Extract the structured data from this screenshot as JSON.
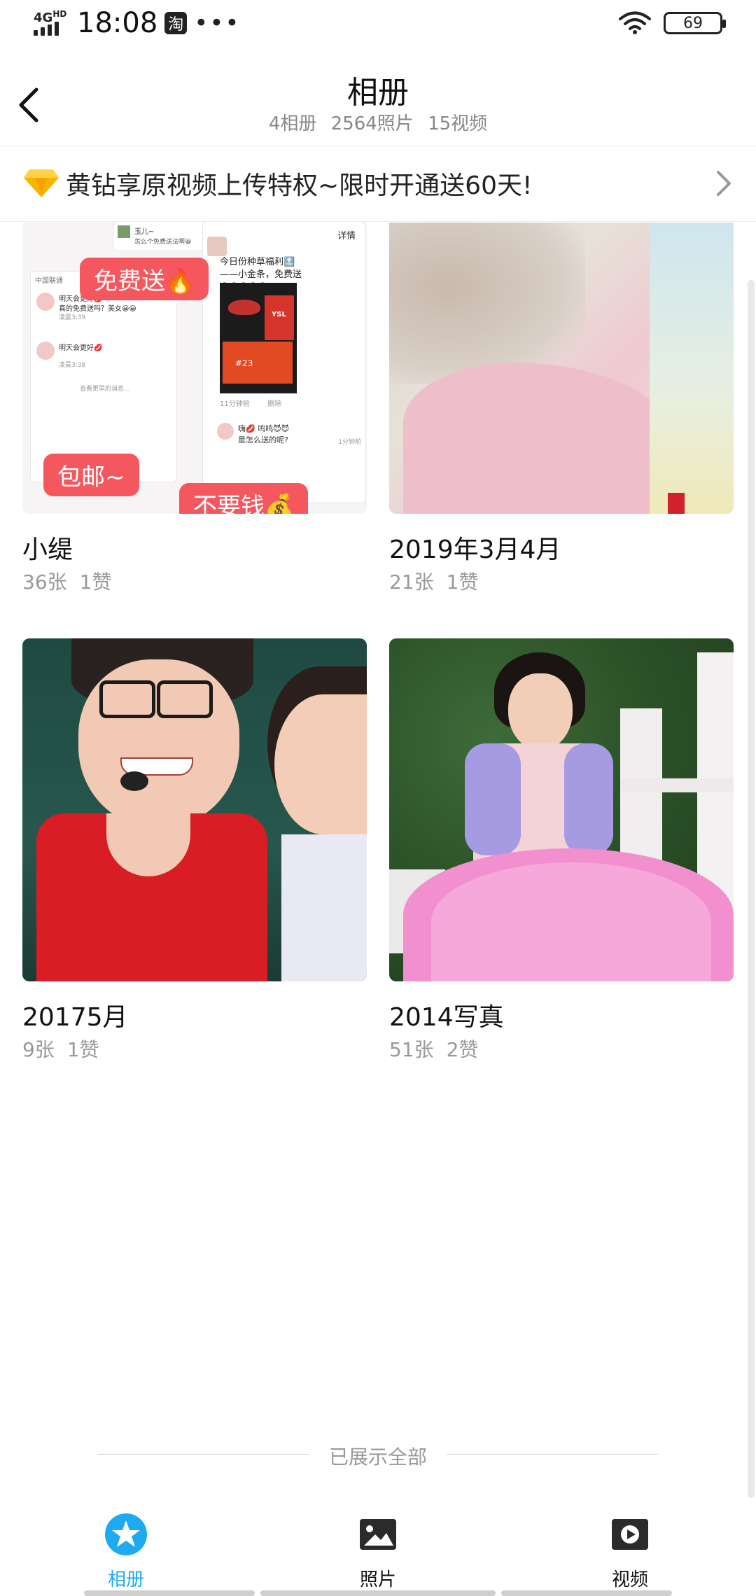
{
  "status_bar": {
    "network": "4G",
    "network_sup": "HD",
    "time": "18:08",
    "app_badge": "淘",
    "more": "•••",
    "battery": "69"
  },
  "header": {
    "title": "相册",
    "albums_count": "4相册",
    "photos_count": "2564照片",
    "videos_count": "15视频"
  },
  "promo": {
    "text": "黄钻享原视频上传特权~限时开通送60天!",
    "icon": "diamond-icon"
  },
  "albums": [
    {
      "name": "小缇",
      "count": "36张",
      "likes": "1赞",
      "thumb_text": {
        "pill_free": "免费送🔥",
        "pill_shipping": "包邮~",
        "pill_nomoney": "不要钱💰",
        "chat_name_1": "玉儿~",
        "chat_line_1": "怎么个免费送法啊😀",
        "carrier": "中国联通",
        "chat_a": "明天会更好💋",
        "chat_a2": "真的免费送吗？美女😀😀",
        "chat_time_a": "凌晨3:39",
        "chat_b": "明天会更好💋",
        "chat_time_b": "凌晨3:38",
        "see_more": "查看更早的消息...",
        "detail": "详情",
        "post_text": "今日份种草福利🔝——小金条，免费送😀😀😀😀😀",
        "brand": "YSL",
        "shade": "#23",
        "post_time": "11分钟前",
        "delete": "删除",
        "comment_name": "嗨💋 鸣鸣😈😈",
        "comment_text": "是怎么送的呢?",
        "comment_time": "1分钟前"
      }
    },
    {
      "name": "2019年3月4月",
      "count": "21张",
      "likes": "1赞"
    },
    {
      "name": "20175月",
      "count": "9张",
      "likes": "1赞"
    },
    {
      "name": "2014写真",
      "count": "51张",
      "likes": "2赞"
    }
  ],
  "footer": {
    "end_text": "已展示全部"
  },
  "tabs": [
    {
      "label": "相册",
      "icon": "album-star-icon",
      "active": true
    },
    {
      "label": "照片",
      "icon": "photo-icon",
      "active": false
    },
    {
      "label": "视频",
      "icon": "video-icon",
      "active": false
    }
  ],
  "colors": {
    "accent": "#1eaaf1",
    "promo_pill": "#f4585e",
    "text_secondary": "#999999"
  }
}
